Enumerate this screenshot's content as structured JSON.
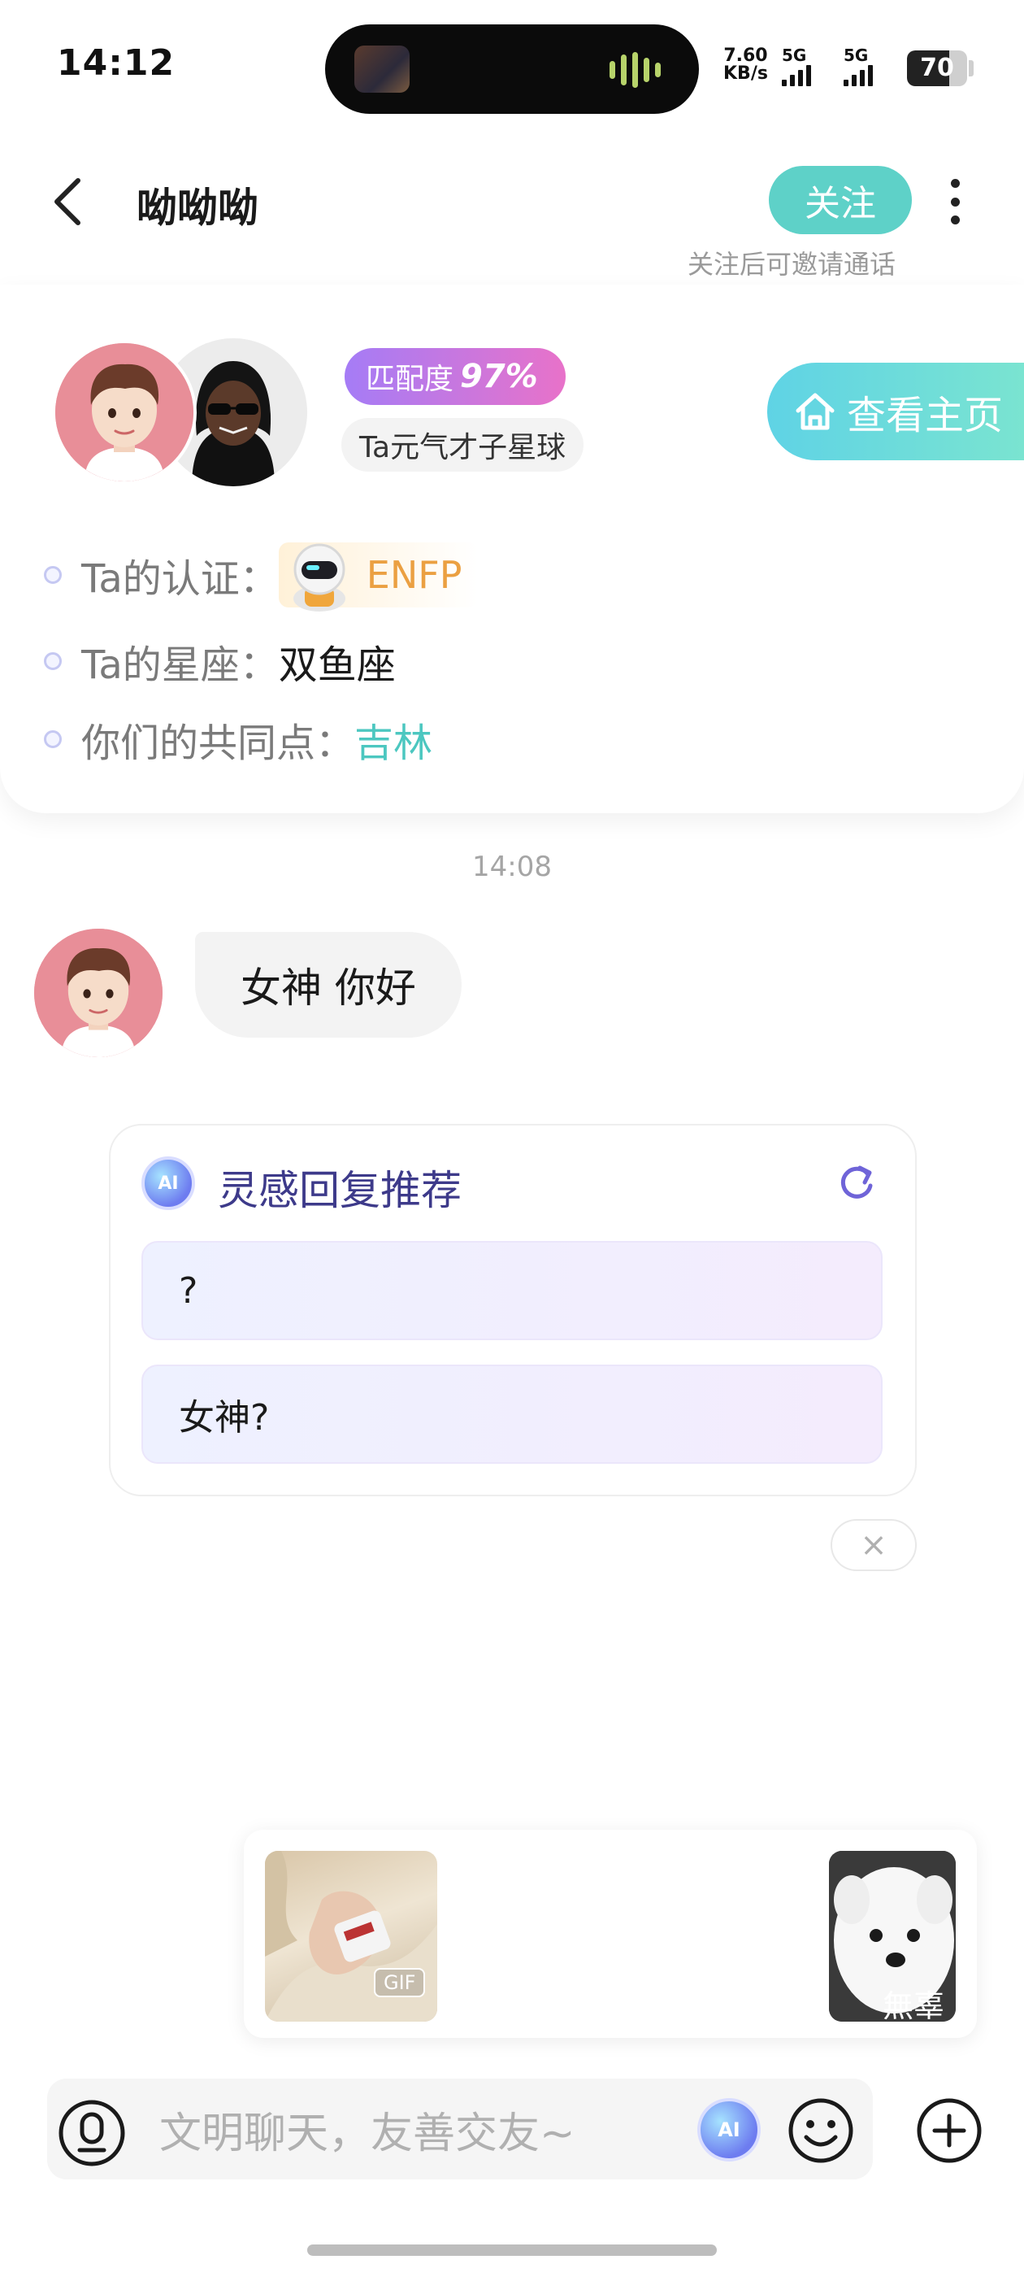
{
  "status_bar": {
    "time": "14:12",
    "net_speed_value": "7.60",
    "net_speed_unit": "KB/s",
    "sim1_label": "5G",
    "sim2_label": "5G",
    "battery_level": "70",
    "battery_fraction": 0.7
  },
  "header": {
    "title": "呦呦呦",
    "follow_label": "关注",
    "follow_hint": "关注后可邀请通话"
  },
  "profile": {
    "match_label": "匹配度",
    "match_value": "97%",
    "planet_tag": "Ta元气才子星球",
    "homepage_label": "查看主页",
    "info": [
      {
        "label": "Ta的认证：",
        "value": "ENFP"
      },
      {
        "label": "Ta的星座：",
        "value": "双鱼座"
      },
      {
        "label": "你们的共同点：",
        "value": "吉林"
      }
    ]
  },
  "chat": {
    "timestamp": "14:08",
    "messages": [
      {
        "text": "女神 你好"
      }
    ]
  },
  "inspiration": {
    "title": "灵感回复推荐",
    "ai_logo_text": "AI",
    "suggestions": [
      "?",
      "女神?"
    ],
    "close_symbol": "×"
  },
  "stickers": {
    "gif_tag": "GIF",
    "caption": "無辜"
  },
  "input": {
    "placeholder": "文明聊天，友善交友~",
    "value": "",
    "ai_button_text": "AI"
  },
  "colors": {
    "accent_teal": "#5ed1c8",
    "match_gradient_start": "#a57cf6",
    "match_gradient_end": "#e872c9",
    "mbti_orange": "#eba042",
    "inspiration_title": "#3d3a8a"
  },
  "icons": {
    "back": "chevron-left-icon",
    "more": "more-vertical-icon",
    "home": "house-icon",
    "refresh": "refresh-icon",
    "close": "close-icon",
    "voice": "voice-icon",
    "emoji": "smile-icon",
    "plus": "plus-circle-icon"
  }
}
